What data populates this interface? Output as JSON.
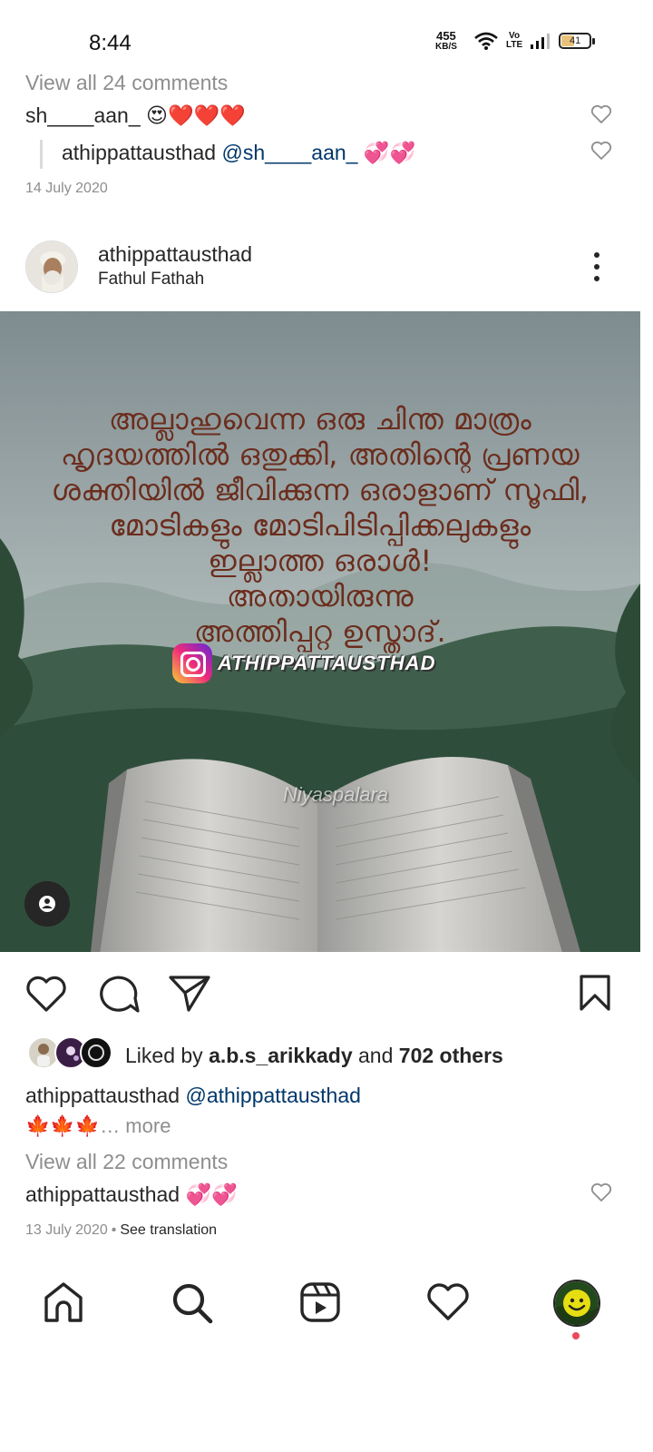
{
  "status_bar": {
    "time": "8:44",
    "net_speed": "455",
    "net_unit": "KB/S",
    "volte": "Vo",
    "lte": "LTE",
    "battery": "41"
  },
  "prev_post": {
    "view_all": "View all 24 comments",
    "comment1": {
      "user": "sh____aan_",
      "text": "😍❤️❤️❤️"
    },
    "reply": {
      "user": "athippattausthad",
      "mention": "@sh____aan_",
      "text": "💞💞"
    },
    "date": "14 July 2020"
  },
  "post": {
    "username": "athippattausthad",
    "location": "Fathul Fathah",
    "image": {
      "quote_lines": [
        "അല്ലാഹുവെന്ന ഒരു ചിന്ത മാത്രം",
        "ഹൃദയത്തിൽ ഒതുക്കി, അതിന്റെ പ്രണയ",
        "ശക്തിയിൽ ജീവിക്കുന്ന ഒരാളാണ് സൂഫി,",
        "മോടികളും മോടിപിടിപ്പിക്കലുകളും",
        "ഇല്ലാത്ത ഒരാൾ!",
        "അതായിരുന്നു",
        "അത്തിപ്പറ്റ ഉസ്താദ്."
      ],
      "ig_handle": "ATHIPPATTAUSTHAD",
      "watermark": "Niyaspalara"
    },
    "likes": {
      "prefix": "Liked by ",
      "user": "a.b.s_arikkady",
      "mid": " and ",
      "others": "702 others"
    },
    "caption": {
      "user": "athippattausthad",
      "mention": "@athippattausthad",
      "emoji": "🍁🍁🍁",
      "more": "… more"
    },
    "view_all": "View all 22 comments",
    "comment": {
      "user": "athippattausthad",
      "text": "💞💞"
    },
    "date": "13 July 2020",
    "date_sep": "•",
    "see_translation": "See translation"
  },
  "icons": {
    "like": "heart-icon",
    "comment": "comment-icon",
    "share": "paper-plane-icon",
    "save": "bookmark-icon",
    "menu": "more-vertical-icon",
    "tag": "person-tag-icon",
    "nav": [
      "home-icon",
      "search-icon",
      "reels-icon",
      "activity-heart-icon",
      "profile-avatar"
    ]
  },
  "colors": {
    "link": "#00376b",
    "muted": "#8e8e8e",
    "text": "#262626",
    "notification": "#ed4956"
  }
}
